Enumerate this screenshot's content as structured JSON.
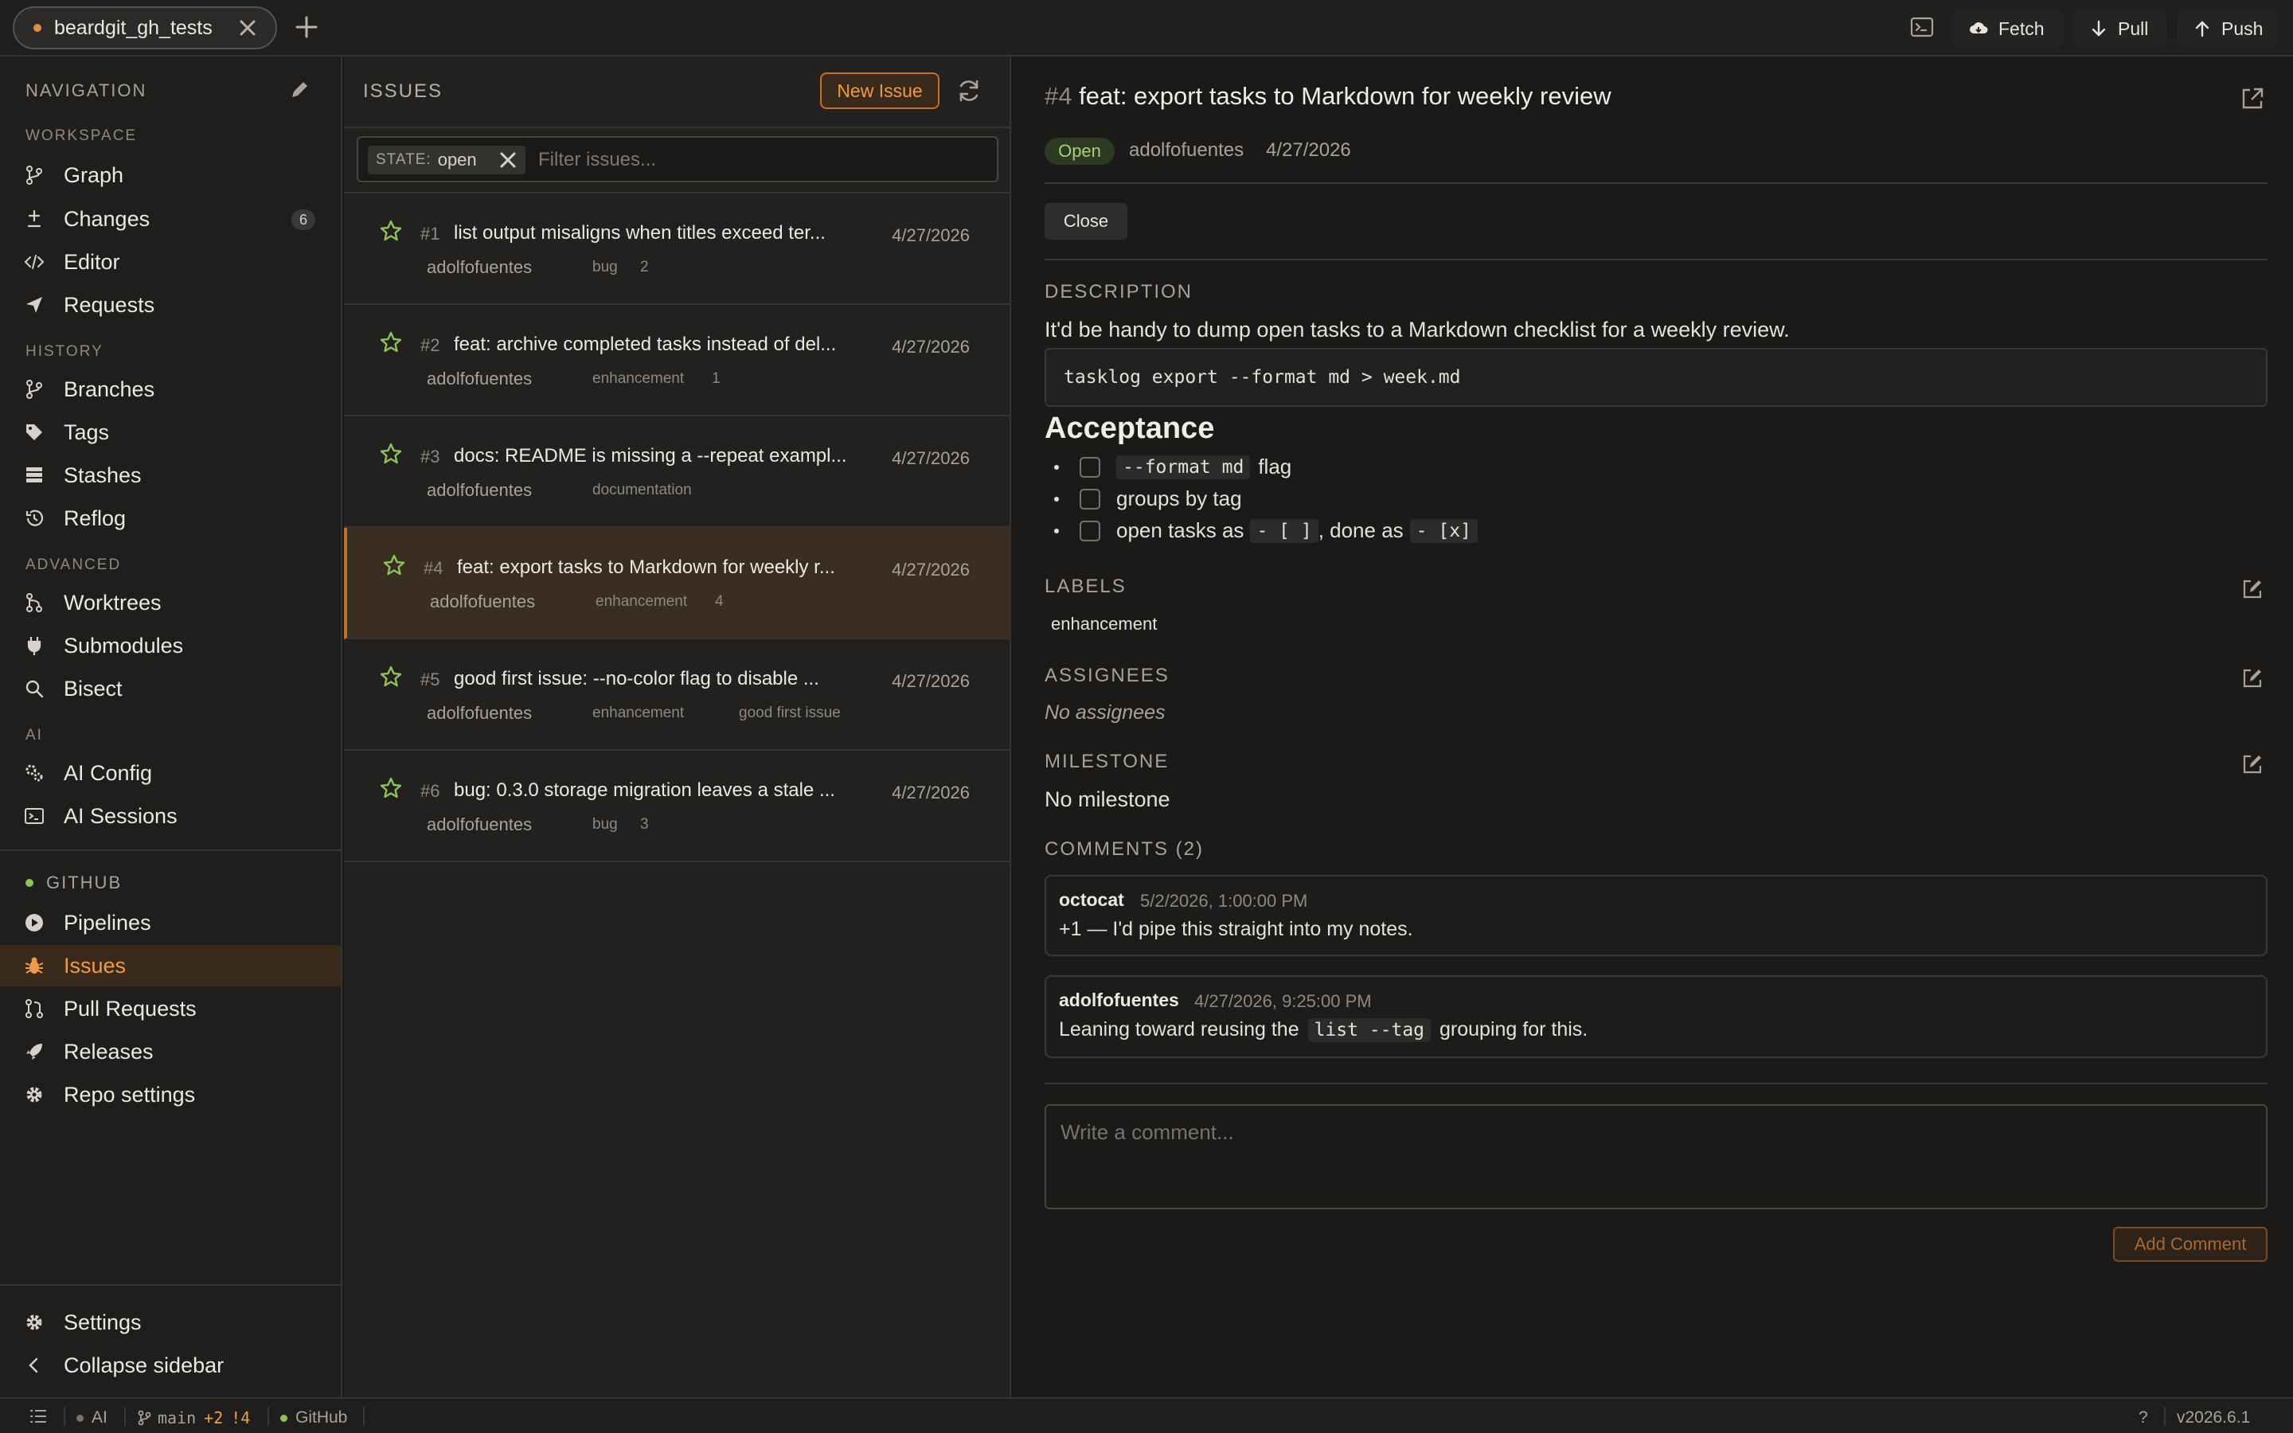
{
  "topbar": {
    "tab_title": "beardgit_gh_tests",
    "fetch": "Fetch",
    "pull": "Pull",
    "push": "Push",
    "accent": "#e88a3c"
  },
  "sidebar": {
    "title": "NAVIGATION",
    "groups": {
      "workspace": "WORKSPACE",
      "history": "HISTORY",
      "advanced": "ADVANCED",
      "ai": "AI"
    },
    "items": {
      "graph": "Graph",
      "changes": "Changes",
      "changes_badge": "6",
      "editor": "Editor",
      "requests": "Requests",
      "branches": "Branches",
      "tags": "Tags",
      "stashes": "Stashes",
      "reflog": "Reflog",
      "worktrees": "Worktrees",
      "submodules": "Submodules",
      "bisect": "Bisect",
      "ai_config": "AI Config",
      "ai_sessions": "AI Sessions"
    },
    "github": {
      "title": "GITHUB",
      "pipelines": "Pipelines",
      "issues": "Issues",
      "pull_requests": "Pull Requests",
      "releases": "Releases",
      "repo_settings": "Repo settings"
    },
    "settings": "Settings",
    "collapse": "Collapse sidebar"
  },
  "issues_list": {
    "title": "ISSUES",
    "new_issue": "New Issue",
    "filter_chip_key": "STATE:",
    "filter_chip_value": "open",
    "filter_placeholder": "Filter issues...",
    "items": [
      {
        "num": "#1",
        "title": "list output misaligns when titles exceed ter...",
        "date": "4/27/2026",
        "author": "adolfofuentes",
        "labels": [
          "bug"
        ],
        "comments": "2"
      },
      {
        "num": "#2",
        "title": "feat: archive completed tasks instead of del...",
        "date": "4/27/2026",
        "author": "adolfofuentes",
        "labels": [
          "enhancement"
        ],
        "comments": "1"
      },
      {
        "num": "#3",
        "title": "docs: README is missing a --repeat exampl...",
        "date": "4/27/2026",
        "author": "adolfofuentes",
        "labels": [
          "documentation"
        ],
        "comments": ""
      },
      {
        "num": "#4",
        "title": "feat: export tasks to Markdown for weekly r...",
        "date": "4/27/2026",
        "author": "adolfofuentes",
        "labels": [
          "enhancement"
        ],
        "comments": "4"
      },
      {
        "num": "#5",
        "title": "good first issue: --no-color flag to disable ...",
        "date": "4/27/2026",
        "author": "adolfofuentes",
        "labels": [
          "enhancement",
          "good first issue"
        ],
        "comments": ""
      },
      {
        "num": "#6",
        "title": "bug: 0.3.0 storage migration leaves a stale ...",
        "date": "4/27/2026",
        "author": "adolfofuentes",
        "labels": [
          "bug"
        ],
        "comments": "3"
      }
    ]
  },
  "detail": {
    "number": "#4",
    "title": "feat: export tasks to Markdown for weekly review",
    "state": "Open",
    "author": "adolfofuentes",
    "date": "4/27/2026",
    "close_label": "Close",
    "description_heading": "DESCRIPTION",
    "description_text": "It'd be handy to dump open tasks to a Markdown checklist for a weekly review.",
    "code": "tasklog export --format md > week.md",
    "acceptance_heading": "Acceptance",
    "checklist": {
      "item1_code": "--format md",
      "item1_text": "flag",
      "item2_text": "groups by tag",
      "item3_pre": "open tasks as",
      "item3_code1": "- [ ]",
      "item3_mid": ", done as",
      "item3_code2": "- [x]"
    },
    "labels_heading": "LABELS",
    "label": "enhancement",
    "assignees_heading": "ASSIGNEES",
    "assignees_text": "No assignees",
    "milestone_heading": "MILESTONE",
    "milestone_text": "No milestone",
    "comments_heading": "COMMENTS (2)",
    "comments": [
      {
        "author": "octocat",
        "time": "5/2/2026, 1:00:00 PM",
        "body": "+1 — I'd pipe this straight into my notes."
      },
      {
        "author": "adolfofuentes",
        "time": "4/27/2026, 9:25:00 PM",
        "body_pre": "Leaning toward reusing the",
        "body_code": "list --tag",
        "body_post": "grouping for this."
      }
    ],
    "comment_placeholder": "Write a comment...",
    "add_comment": "Add Comment"
  },
  "statusbar": {
    "ai": "AI",
    "branch": "main",
    "ahead": "+2",
    "changed": "!4",
    "github": "GitHub",
    "help": "?",
    "version": "v2026.6.1"
  }
}
